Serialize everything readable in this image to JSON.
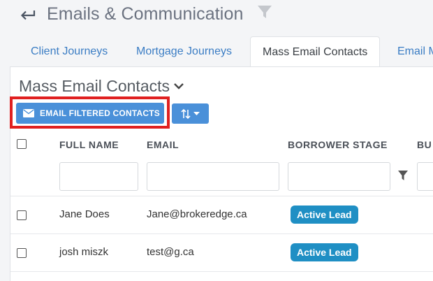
{
  "header": {
    "title": "Emails & Communication"
  },
  "tabs": [
    {
      "label": "Client Journeys",
      "active": false
    },
    {
      "label": "Mortgage Journeys",
      "active": false
    },
    {
      "label": "Mass Email Contacts",
      "active": true
    },
    {
      "label": "Email M",
      "active": false
    }
  ],
  "section": {
    "title": "Mass Email Contacts"
  },
  "toolbar": {
    "email_button_label": "EMAIL FILTERED CONTACTS",
    "sort_button_icon": "sort-arrows-icon"
  },
  "table": {
    "columns": [
      "FULL NAME",
      "EMAIL",
      "BORROWER STAGE",
      "BU"
    ],
    "rows": [
      {
        "full_name": "Jane Does",
        "email": "Jane@brokeredge.ca",
        "borrower_stage": "Active Lead"
      },
      {
        "full_name": "josh miszk",
        "email": "test@g.ca",
        "borrower_stage": "Active Lead"
      }
    ]
  },
  "colors": {
    "primary": "#4a90d9",
    "badge": "#1f8fc4",
    "highlight": "#e02020",
    "tab_link": "#3b7dc4"
  }
}
